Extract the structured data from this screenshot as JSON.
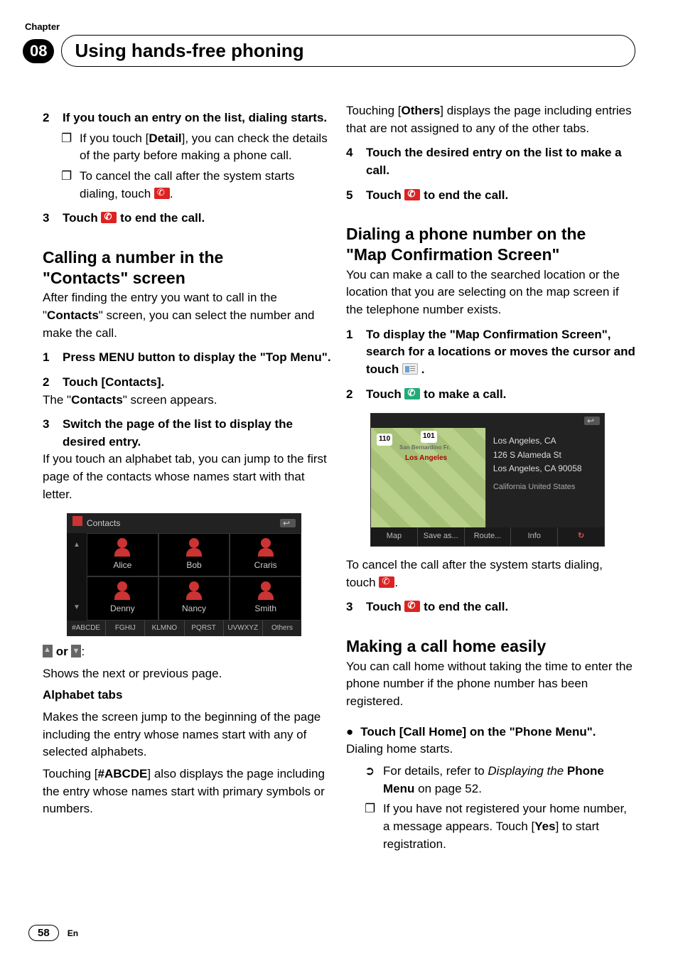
{
  "header": {
    "chapter_label": "Chapter",
    "chapter_number": "08",
    "title": "Using hands-free phoning"
  },
  "left": {
    "step2": {
      "num": "2",
      "text": "If you touch an entry on the list, dialing starts."
    },
    "step2_b1": {
      "pre": "If you touch [",
      "detail": "Detail",
      "post": "], you can check the details of the party before making a phone call."
    },
    "step2_b2": {
      "pre": "To cancel the call after the system starts dialing, touch ",
      "post": "."
    },
    "step3": {
      "num": "3",
      "pre": "Touch ",
      "post": " to end the call."
    },
    "h_calling": {
      "l1": "Calling a number in the",
      "l2_pre": "\"",
      "l2_mid": "Contacts",
      "l2_post": "\" screen"
    },
    "calling_intro": {
      "pre": "After finding the entry you want to call in the \"",
      "mid": "Contacts",
      "post": "\" screen, you can select the number and make the call."
    },
    "c1": {
      "num": "1",
      "text": "Press MENU button to display the \"Top Menu\"."
    },
    "c2": {
      "num": "2",
      "text": "Touch [Contacts]."
    },
    "c2_after": {
      "pre": "The \"",
      "mid": "Contacts",
      "post": "\" screen appears."
    },
    "c3": {
      "num": "3",
      "text": "Switch the page of the list to display the desired entry."
    },
    "c3_after": "If you touch an alphabet tab, you can jump to the first page of the contacts whose names start with that letter.",
    "shot": {
      "title": "Contacts",
      "names": [
        "Alice",
        "Bob",
        "Craris",
        "Denny",
        "Nancy",
        "Smith"
      ],
      "tabs": [
        "#ABCDE",
        "FGHIJ",
        "KLMNO",
        "PQRST",
        "UVWXYZ",
        "Others"
      ]
    },
    "nav_or": " or ",
    "nav_colon": ":",
    "nav_desc": "Shows the next or previous page.",
    "alpha_h": "Alphabet tabs",
    "alpha_desc": "Makes the screen jump to the beginning of the page including the entry whose names start with any of selected alphabets.",
    "abcde": {
      "pre": "Touching [",
      "mid": "#ABCDE",
      "post": "] also displays the page including the entry whose names start with primary symbols or numbers."
    }
  },
  "right": {
    "others": {
      "pre": "Touching [",
      "mid": "Others",
      "post": "] displays the page including entries that are not assigned to any of the other tabs."
    },
    "r4": {
      "num": "4",
      "text": "Touch the desired entry on the list to make a call."
    },
    "r5": {
      "num": "5",
      "pre": "Touch ",
      "post": " to end the call."
    },
    "h_map": {
      "l1": "Dialing a phone number on the",
      "l2": "\"Map Confirmation Screen\""
    },
    "map_intro": "You can make a call to the searched location or the location that you are selecting on the map screen if the telephone number exists.",
    "m1": {
      "num": "1",
      "pre": "To display the \"Map Confirmation Screen\", search for a locations or moves the cursor and touch ",
      "post": " ."
    },
    "m2": {
      "num": "2",
      "pre": "Touch ",
      "post": " to make a call."
    },
    "mapshot": {
      "shields": [
        "110",
        "101"
      ],
      "city": "Los Angeles",
      "hood": "San Bernardino Fr.",
      "info_l1": "Los Angeles, CA",
      "info_l2": "126 S Alameda St",
      "info_l3": "Los Angeles, CA 90058",
      "info_sub": "California   United States",
      "buttons": [
        "Map",
        "Save as...",
        "Route...",
        "Info"
      ]
    },
    "cancel": {
      "pre": "To cancel the call after the system starts dialing, touch ",
      "post": "."
    },
    "m3": {
      "num": "3",
      "pre": "Touch ",
      "post": " to end the call."
    },
    "h_home": "Making a call home easily",
    "home_intro": "You can call home without taking the time to enter the phone number if the phone number has been registered.",
    "home_step": "Touch [Call Home] on the \"Phone Menu\".",
    "home_after": "Dialing home starts.",
    "home_b1": {
      "pre": "For details, refer to ",
      "ital": "Displaying the",
      "bold": " Phone Menu",
      "post": " on page 52."
    },
    "home_b2": {
      "pre": "If you have not registered your home number, a message appears. Touch [",
      "mid": "Yes",
      "post": "] to start registration."
    }
  },
  "footer": {
    "page": "58",
    "lang": "En"
  }
}
